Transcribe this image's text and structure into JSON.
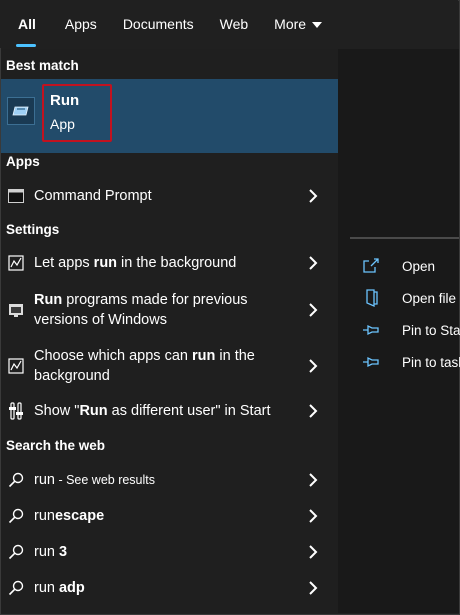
{
  "tabs": [
    {
      "label": "All",
      "active": true
    },
    {
      "label": "Apps"
    },
    {
      "label": "Documents"
    },
    {
      "label": "Web"
    },
    {
      "label": "More"
    }
  ],
  "best_match": {
    "heading": "Best match",
    "title": "Run",
    "subtitle": "App",
    "icon": "run-icon",
    "highlight_color": "#c1121f"
  },
  "apps_section": {
    "heading": "Apps",
    "items": [
      {
        "label": "Command Prompt",
        "icon": "command-prompt-icon"
      }
    ]
  },
  "settings_section": {
    "heading": "Settings",
    "items": [
      {
        "pre": "Let apps ",
        "bold": "run",
        "post": " in the background",
        "icon": "background-apps-icon"
      },
      {
        "pre": "",
        "bold": "Run",
        "post": " programs made for previous versions of Windows",
        "icon": "compatibility-icon"
      },
      {
        "pre": "Choose which apps can ",
        "bold": "run",
        "post": " in the background",
        "icon": "background-apps-icon"
      },
      {
        "pre": "Show \"",
        "bold": "Run",
        "post": " as different user\" in Start",
        "icon": "start-settings-icon"
      }
    ]
  },
  "web_section": {
    "heading": "Search the web",
    "items": [
      {
        "pre": "run",
        "bold": "",
        "post": "",
        "suffix": " - See web results",
        "icon": "search-icon"
      },
      {
        "pre": "run",
        "bold": "escape",
        "post": "",
        "suffix": "",
        "icon": "search-icon"
      },
      {
        "pre": "run",
        "bold": " 3",
        "post": "",
        "suffix": "",
        "icon": "search-icon"
      },
      {
        "pre": "run",
        "bold": " adp",
        "post": "",
        "suffix": "",
        "icon": "search-icon"
      }
    ]
  },
  "preview_actions": [
    {
      "label": "Open",
      "icon": "open-icon"
    },
    {
      "label": "Open file",
      "icon": "open-file-location-icon"
    },
    {
      "label": "Pin to Star",
      "icon": "pin-icon"
    },
    {
      "label": "Pin to task",
      "icon": "pin-icon"
    }
  ],
  "colors": {
    "accent": "#4cc2ff",
    "selected_background": "#224b6a",
    "panel_background": "#1f1f1f"
  }
}
